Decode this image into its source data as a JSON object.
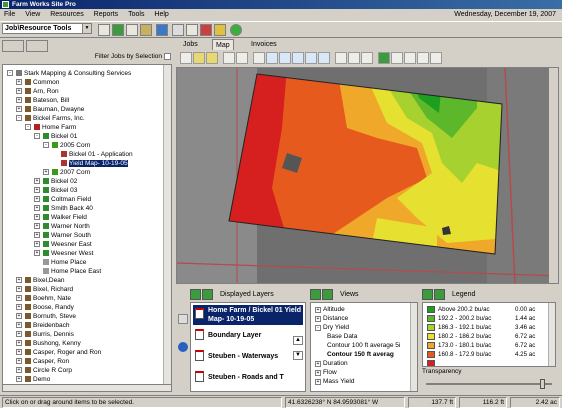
{
  "app": {
    "title": "Farm Works Site Pro",
    "date": "Wednesday, December 19, 2007"
  },
  "menu": [
    "File",
    "View",
    "Resources",
    "Reports",
    "Tools",
    "Help"
  ],
  "toolbar": {
    "combo": "Job\\Resource Tools"
  },
  "left": {
    "filter_label": "Filter Jobs by Selection"
  },
  "tree": [
    {
      "label": "Stark Mapping & Consulting Services",
      "indent": 1,
      "exp": "-",
      "icon": "#777"
    },
    {
      "label": "Common",
      "indent": 2,
      "exp": "+",
      "icon": "#7a5a2a"
    },
    {
      "label": "Arn, Ron",
      "indent": 2,
      "exp": "+",
      "icon": "#7a5a2a"
    },
    {
      "label": "Bateson, Bill",
      "indent": 2,
      "exp": "+",
      "icon": "#7a5a2a"
    },
    {
      "label": "Bauman, Dwayne",
      "indent": 2,
      "exp": "+",
      "icon": "#7a5a2a"
    },
    {
      "label": "Bickel Farms, Inc.",
      "indent": 2,
      "exp": "-",
      "icon": "#7a5a2a"
    },
    {
      "label": "Home Farm",
      "indent": 3,
      "exp": "-",
      "icon": "#b22222"
    },
    {
      "label": "Bickel 01",
      "indent": 4,
      "exp": "-",
      "icon": "#2e8b2e"
    },
    {
      "label": "2005 Corn",
      "indent": 5,
      "exp": "-",
      "icon": "#3a9a1a"
    },
    {
      "label": "Bickel 01 - Application",
      "indent": 6,
      "exp": "",
      "icon": "#a33"
    },
    {
      "label": "Yield Map- 10-19-05",
      "indent": 6,
      "exp": "",
      "icon": "#a33",
      "selected": true
    },
    {
      "label": "2007 Corn",
      "indent": 5,
      "exp": "+",
      "icon": "#3a9a1a"
    },
    {
      "label": "Bickel 02",
      "indent": 4,
      "exp": "+",
      "icon": "#2e8b2e"
    },
    {
      "label": "Bickel 03",
      "indent": 4,
      "exp": "+",
      "icon": "#2e8b2e"
    },
    {
      "label": "Coltman Field",
      "indent": 4,
      "exp": "+",
      "icon": "#2e8b2e"
    },
    {
      "label": "Smith Back 40",
      "indent": 4,
      "exp": "+",
      "icon": "#2e8b2e"
    },
    {
      "label": "Walker Field",
      "indent": 4,
      "exp": "+",
      "icon": "#2e8b2e"
    },
    {
      "label": "Warner North",
      "indent": 4,
      "exp": "+",
      "icon": "#2e8b2e"
    },
    {
      "label": "Warner South",
      "indent": 4,
      "exp": "+",
      "icon": "#2e8b2e"
    },
    {
      "label": "Weesner East",
      "indent": 4,
      "exp": "+",
      "icon": "#2e8b2e"
    },
    {
      "label": "Weesner West",
      "indent": 4,
      "exp": "+",
      "icon": "#2e8b2e"
    },
    {
      "label": "Home Place",
      "indent": 4,
      "exp": "",
      "icon": "#999"
    },
    {
      "label": "Home Place East",
      "indent": 4,
      "exp": "",
      "icon": "#999"
    },
    {
      "label": "Bixel,Dean",
      "indent": 2,
      "exp": "+",
      "icon": "#7a5a2a"
    },
    {
      "label": "Bixel, Richard",
      "indent": 2,
      "exp": "+",
      "icon": "#7a5a2a"
    },
    {
      "label": "Boehm, Nate",
      "indent": 2,
      "exp": "+",
      "icon": "#7a5a2a"
    },
    {
      "label": "Boose, Randy",
      "indent": 2,
      "exp": "+",
      "icon": "#7a5a2a"
    },
    {
      "label": "Bornuth, Steve",
      "indent": 2,
      "exp": "+",
      "icon": "#7a5a2a"
    },
    {
      "label": "Breidenbach",
      "indent": 2,
      "exp": "+",
      "icon": "#7a5a2a"
    },
    {
      "label": "Burris, Dennis",
      "indent": 2,
      "exp": "+",
      "icon": "#7a5a2a"
    },
    {
      "label": "Bushong, Kenny",
      "indent": 2,
      "exp": "+",
      "icon": "#7a5a2a"
    },
    {
      "label": "Casper, Roger and Ron",
      "indent": 2,
      "exp": "+",
      "icon": "#7a5a2a"
    },
    {
      "label": "Casper, Ron",
      "indent": 2,
      "exp": "+",
      "icon": "#7a5a2a"
    },
    {
      "label": "Circle R Corp",
      "indent": 2,
      "exp": "+",
      "icon": "#7a5a2a"
    },
    {
      "label": "Demo",
      "indent": 2,
      "exp": "+",
      "icon": "#7a5a2a"
    },
    {
      "label": "Dulin, Dean",
      "indent": 2,
      "exp": "+",
      "icon": "#7a5a2a"
    }
  ],
  "tabs": {
    "jobs": "Jobs",
    "map": "Map",
    "invoices": "Invoices"
  },
  "layers": {
    "header": "Displayed Layers",
    "items": [
      {
        "label": "Home Farm / Bickel 01 Yield Map- 10-19-05",
        "selected": true
      },
      {
        "label": "Boundary Layer"
      },
      {
        "label": "Steuben - Waterways"
      },
      {
        "label": "Steuben - Roads and T"
      }
    ]
  },
  "views": {
    "header": "Views",
    "items": [
      {
        "label": "Altitude",
        "indent": 0,
        "exp": "+"
      },
      {
        "label": "Distance",
        "indent": 0,
        "exp": "+"
      },
      {
        "label": "Dry Yield",
        "indent": 0,
        "exp": "-"
      },
      {
        "label": "Base Data",
        "indent": 1,
        "exp": ""
      },
      {
        "label": "Contour 100 ft average 5i",
        "indent": 1,
        "exp": ""
      },
      {
        "label": "Contour 150 ft averag",
        "indent": 1,
        "exp": "",
        "bold": true
      },
      {
        "label": "Duration",
        "indent": 0,
        "exp": "+"
      },
      {
        "label": "Flow",
        "indent": 0,
        "exp": "+"
      },
      {
        "label": "Mass Yield",
        "indent": 0,
        "exp": "+"
      }
    ]
  },
  "legend": {
    "header": "Legend",
    "transparency_label": "Transparency",
    "rows": [
      {
        "range": "Above 200.2 bu/ac",
        "area": "0.00 ac",
        "color": "#1e9e1e"
      },
      {
        "range": "192.2 - 200.2 bu/ac",
        "area": "1.44 ac",
        "color": "#5cb82a"
      },
      {
        "range": "186.3 - 192.1 bu/ac",
        "area": "3.46 ac",
        "color": "#a6d12e"
      },
      {
        "range": "180.2 - 186.2 bu/ac",
        "area": "6.72 ac",
        "color": "#e6e030"
      },
      {
        "range": "173.0 - 180.1 bu/ac",
        "area": "6.72 ac",
        "color": "#f0a82a"
      },
      {
        "range": "160.8 - 172.9 bu/ac",
        "area": "4.25 ac",
        "color": "#e65a1e"
      },
      {
        "range": "",
        "area": "",
        "color": "#d62020"
      }
    ]
  },
  "status": {
    "hint": "Click on or drag around items to be selected.",
    "coords": "41.6326238° N  84.9593081° W",
    "dist1": "137.7 ft",
    "dist2": "116.2 ft",
    "area": "2.42 ac"
  }
}
